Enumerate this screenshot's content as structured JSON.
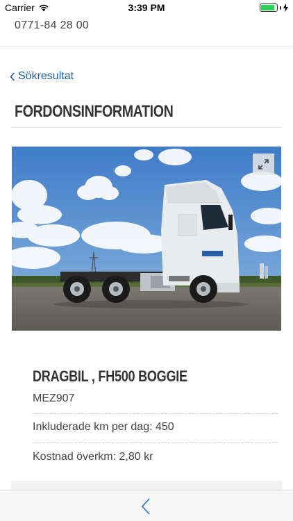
{
  "status_bar": {
    "carrier": "Carrier",
    "time": "3:39 PM",
    "battery_level": 0.85,
    "battery_color": "#2fd15a"
  },
  "header": {
    "phone": "0771-84 28 00"
  },
  "nav": {
    "back_label": "Sökresultat",
    "link_color": "#1f5fa8"
  },
  "page": {
    "section_title": "FORDONSINFORMATION"
  },
  "vehicle": {
    "title": "DRAGBIL , FH500 BOGGIE",
    "registration": "MEZ907",
    "included_km": "Inkluderade km per dag: 450",
    "extra_km_cost": "Kostnad överkm: 2,80 kr"
  },
  "icons": {
    "expand": "expand-icon",
    "back": "chevron-left-icon"
  }
}
